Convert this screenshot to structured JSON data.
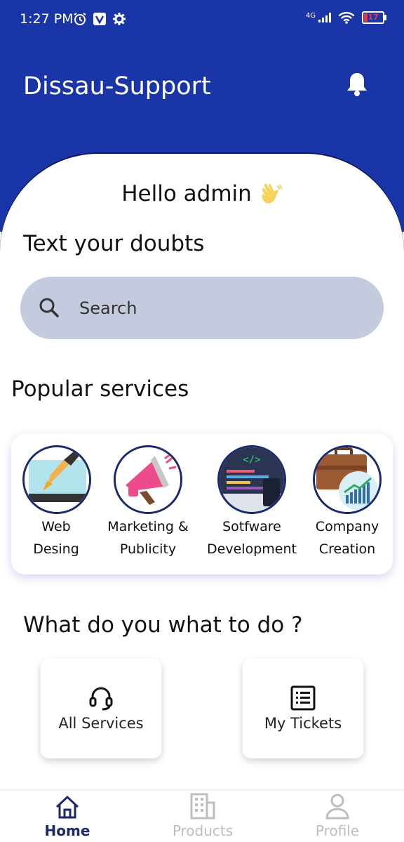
{
  "status_bar": {
    "time": "1:27 PM",
    "network": "4G",
    "battery": "17"
  },
  "header": {
    "title": "Dissau-Support",
    "notification_icon": "bell-icon"
  },
  "greeting": {
    "text": "Hello admin",
    "icon": "waving-hand-icon"
  },
  "doubts": {
    "heading": "Text your doubts",
    "search_placeholder": "Search"
  },
  "popular": {
    "heading": "Popular services",
    "items": [
      {
        "line1": "Web",
        "line2": "Desing",
        "icon": "web-design-icon"
      },
      {
        "line1": "Marketing &",
        "line2": "Publicity",
        "icon": "megaphone-icon"
      },
      {
        "line1": "Sotfware",
        "line2": "Development",
        "icon": "code-monitor-icon"
      },
      {
        "line1": "Company",
        "line2": "Creation",
        "icon": "briefcase-growth-icon"
      }
    ]
  },
  "actions": {
    "heading": "What do you what to do ?",
    "all_services": "All Services",
    "my_tickets": "My Tickets"
  },
  "bottom_nav": {
    "home": "Home",
    "products": "Products",
    "profile": "Profile"
  },
  "colors": {
    "primary": "#1a35a8",
    "search_bg": "#c5cbde",
    "nav_active": "#1a2a6c",
    "nav_inactive": "#bdbdbd"
  }
}
